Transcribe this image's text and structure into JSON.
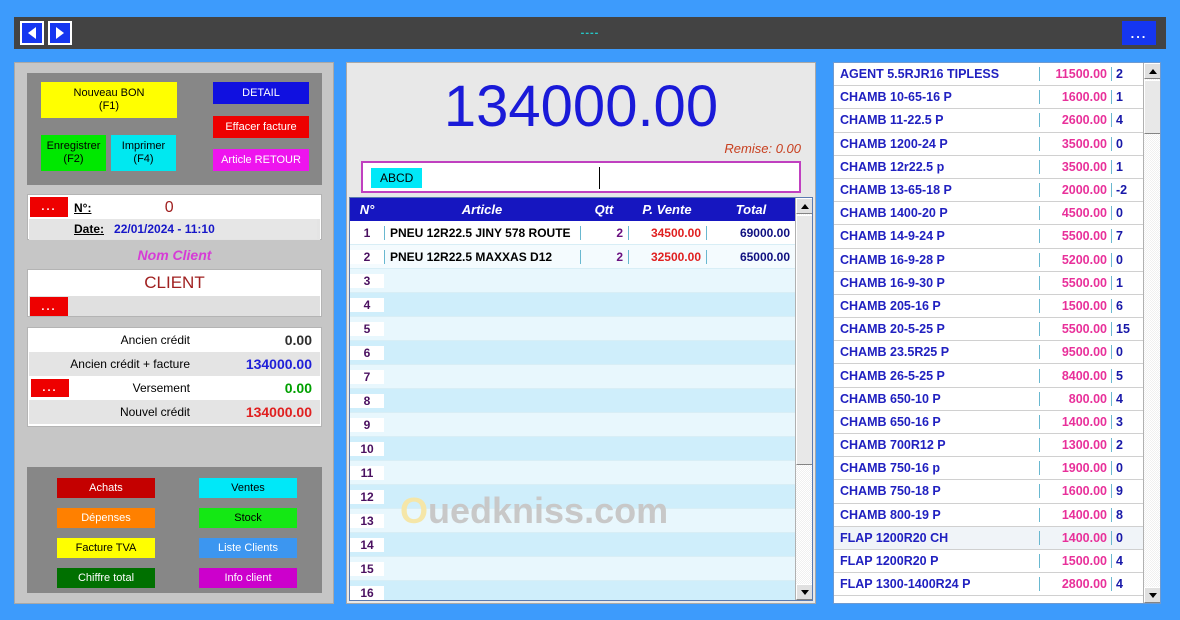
{
  "titlebar": {
    "prev_icon": "triangle-left-icon",
    "next_icon": "triangle-right-icon",
    "center_text": "----",
    "menu_label": "..."
  },
  "actions": {
    "nouveau_bon": "Nouveau BON",
    "nouveau_bon_key": "(F1)",
    "enregistrer": "Enregistrer",
    "enregistrer_key": "(F2)",
    "imprimer": "Imprimer",
    "imprimer_key": "(F4)",
    "detail": "DETAIL",
    "effacer_facture": "Effacer facture",
    "article_retour": "Article RETOUR"
  },
  "invoice_header": {
    "dots": "...",
    "numero_label": "N°:",
    "numero_value": "0",
    "date_label": "Date:",
    "date_value": "22/01/2024 - 11:10"
  },
  "client": {
    "title": "Nom Client",
    "name": "CLIENT",
    "dots": "..."
  },
  "credit": {
    "rows": [
      {
        "label": "Ancien crédit",
        "value": "0.00",
        "color": "#303030",
        "dots": false
      },
      {
        "label": "Ancien crédit + facture",
        "value": "134000.00",
        "color": "#2020d8",
        "dots": false
      },
      {
        "label": "Versement",
        "value": "0.00",
        "color": "#00a000",
        "dots": true
      },
      {
        "label": "Nouvel crédit",
        "value": "134000.00",
        "color": "#e02020",
        "dots": false
      }
    ],
    "dots": "..."
  },
  "nav_buttons": [
    {
      "label": "Achats",
      "class": "g-achats"
    },
    {
      "label": "Dépenses",
      "class": "g-depenses"
    },
    {
      "label": "Facture TVA",
      "class": "g-tva"
    },
    {
      "label": "Chiffre total",
      "class": "g-chiffre"
    },
    {
      "label": "Ventes",
      "class": "g-ventes"
    },
    {
      "label": "Stock",
      "class": "g-stock"
    },
    {
      "label": "Liste Clients",
      "class": "g-liste"
    },
    {
      "label": "Info client",
      "class": "g-info"
    }
  ],
  "center": {
    "total": "134000.00",
    "remise": "Remise: 0.00",
    "search_tag": "ABCD",
    "search_value": ""
  },
  "invoice_table": {
    "columns": [
      "N°",
      "Article",
      "Qtt",
      "P. Vente",
      "Total"
    ],
    "rows": [
      {
        "no": "1",
        "article": "PNEU 12R22.5  JINY 578 ROUTE",
        "qtt": "2",
        "pv": "34500.00",
        "total": "69000.00"
      },
      {
        "no": "2",
        "article": "PNEU 12R22.5 MAXXAS D12",
        "qtt": "2",
        "pv": "32500.00",
        "total": "65000.00"
      },
      {
        "no": "3",
        "article": "",
        "qtt": "",
        "pv": "",
        "total": ""
      },
      {
        "no": "4",
        "article": "",
        "qtt": "",
        "pv": "",
        "total": ""
      },
      {
        "no": "5",
        "article": "",
        "qtt": "",
        "pv": "",
        "total": ""
      },
      {
        "no": "6",
        "article": "",
        "qtt": "",
        "pv": "",
        "total": ""
      },
      {
        "no": "7",
        "article": "",
        "qtt": "",
        "pv": "",
        "total": ""
      },
      {
        "no": "8",
        "article": "",
        "qtt": "",
        "pv": "",
        "total": ""
      },
      {
        "no": "9",
        "article": "",
        "qtt": "",
        "pv": "",
        "total": ""
      },
      {
        "no": "10",
        "article": "",
        "qtt": "",
        "pv": "",
        "total": ""
      },
      {
        "no": "11",
        "article": "",
        "qtt": "",
        "pv": "",
        "total": ""
      },
      {
        "no": "12",
        "article": "",
        "qtt": "",
        "pv": "",
        "total": ""
      },
      {
        "no": "13",
        "article": "",
        "qtt": "",
        "pv": "",
        "total": ""
      },
      {
        "no": "14",
        "article": "",
        "qtt": "",
        "pv": "",
        "total": ""
      },
      {
        "no": "15",
        "article": "",
        "qtt": "",
        "pv": "",
        "total": ""
      },
      {
        "no": "16",
        "article": "",
        "qtt": "",
        "pv": "",
        "total": ""
      }
    ]
  },
  "watermark": {
    "first": "O",
    "rest": "uedkniss.com"
  },
  "product_list": {
    "rows": [
      {
        "name": "AGENT 5.5RJR16 TIPLESS",
        "price": "11500.00",
        "stock": "2"
      },
      {
        "name": "CHAMB 10-65-16 P",
        "price": "1600.00",
        "stock": "1"
      },
      {
        "name": "CHAMB 11-22.5 P",
        "price": "2600.00",
        "stock": "4"
      },
      {
        "name": "CHAMB 1200-24 P",
        "price": "3500.00",
        "stock": "0"
      },
      {
        "name": "CHAMB 12r22.5 p",
        "price": "3500.00",
        "stock": "1"
      },
      {
        "name": "CHAMB 13-65-18 P",
        "price": "2000.00",
        "stock": "-2"
      },
      {
        "name": "CHAMB 1400-20 P",
        "price": "4500.00",
        "stock": "0"
      },
      {
        "name": "CHAMB 14-9-24 P",
        "price": "5500.00",
        "stock": "7"
      },
      {
        "name": "CHAMB 16-9-28 P",
        "price": "5200.00",
        "stock": "0"
      },
      {
        "name": "CHAMB 16-9-30 P",
        "price": "5500.00",
        "stock": "1"
      },
      {
        "name": "CHAMB 205-16 P",
        "price": "1500.00",
        "stock": "6"
      },
      {
        "name": "CHAMB 20-5-25 P",
        "price": "5500.00",
        "stock": "15"
      },
      {
        "name": "CHAMB 23.5R25 P",
        "price": "9500.00",
        "stock": "0"
      },
      {
        "name": "CHAMB 26-5-25 P",
        "price": "8400.00",
        "stock": "5"
      },
      {
        "name": "CHAMB 650-10 P",
        "price": "800.00",
        "stock": "4"
      },
      {
        "name": "CHAMB 650-16 P",
        "price": "1400.00",
        "stock": "3"
      },
      {
        "name": "CHAMB 700R12 P",
        "price": "1300.00",
        "stock": "2"
      },
      {
        "name": "CHAMB 750-16 p",
        "price": "1900.00",
        "stock": "0"
      },
      {
        "name": "CHAMB 750-18 P",
        "price": "1600.00",
        "stock": "9"
      },
      {
        "name": "CHAMB 800-19 P",
        "price": "1400.00",
        "stock": "8"
      },
      {
        "name": "FLAP 1200R20 CH",
        "price": "1400.00",
        "stock": "0"
      },
      {
        "name": "FLAP 1200R20 P",
        "price": "1500.00",
        "stock": "4"
      },
      {
        "name": "FLAP 1300-1400R24 P",
        "price": "2800.00",
        "stock": "4"
      }
    ]
  },
  "colors": {
    "desktop": "#3d9bfc",
    "panel": "#c6c6c6",
    "accent_blue": "#1616c0",
    "total_blue": "#1a1ad8",
    "price_pink": "#e8309a"
  }
}
